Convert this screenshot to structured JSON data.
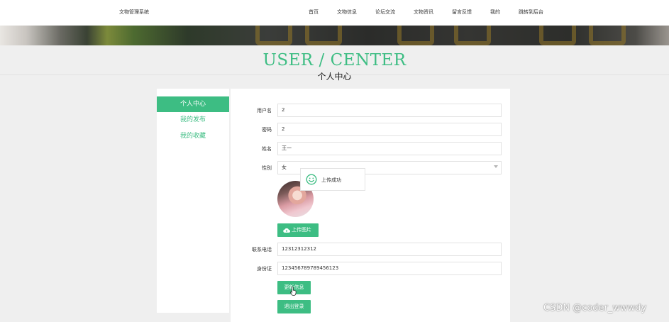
{
  "header": {
    "brand": "文物管理系统",
    "nav": [
      "首页",
      "文物信息",
      "论坛交流",
      "文物资讯",
      "留言反馈",
      "我的",
      "跳转到后台"
    ]
  },
  "page": {
    "title_en": "USER / CENTER",
    "title_cn": "个人中心"
  },
  "sidebar": {
    "items": [
      {
        "label": "个人中心",
        "active": true
      },
      {
        "label": "我的发布",
        "active": false
      },
      {
        "label": "我的收藏",
        "active": false
      }
    ]
  },
  "form": {
    "username": {
      "label": "用户名",
      "value": "2"
    },
    "password": {
      "label": "密码",
      "value": "2"
    },
    "name": {
      "label": "姓名",
      "value": "王一"
    },
    "gender": {
      "label": "性别",
      "value": "女"
    },
    "upload_label": "上传图片",
    "phone": {
      "label": "联系电话",
      "value": "12312312312"
    },
    "id_card": {
      "label": "身份证",
      "value": "123456789789456123"
    },
    "update_label": "更新信息",
    "logout_label": "退出登录"
  },
  "toast": {
    "message": "上传成功"
  },
  "watermark": "CSDN @coder_wwwdy",
  "colors": {
    "accent": "#3dbd83",
    "background": "#efefef"
  }
}
